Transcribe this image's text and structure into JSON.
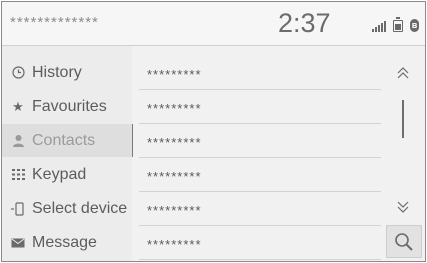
{
  "status": {
    "title": "*************",
    "clock": "2:37",
    "icons": [
      "signal-icon",
      "battery-icon",
      "bluetooth-icon"
    ]
  },
  "sidebar": {
    "items": [
      {
        "label": "History",
        "icon": "clock-icon",
        "active": false
      },
      {
        "label": "Favourites",
        "icon": "star-icon",
        "active": false
      },
      {
        "label": "Contacts",
        "icon": "person-icon",
        "active": true
      },
      {
        "label": "Keypad",
        "icon": "keypad-icon",
        "active": false
      },
      {
        "label": "Select device",
        "icon": "phone-icon",
        "active": false
      },
      {
        "label": "Message",
        "icon": "envelope-icon",
        "active": false
      }
    ]
  },
  "list": {
    "rows": [
      "*********",
      "*********",
      "*********",
      "*********",
      "*********",
      "*********"
    ]
  },
  "controls": {
    "scroll_up": "chevron-up-icon",
    "scroll_down": "chevron-down-icon",
    "search": "search-icon"
  },
  "colors": {
    "background": "#f1f1f1",
    "text": "#5c5c5c",
    "active_text": "#9b9b9b",
    "divider": "#d3d3d3"
  }
}
